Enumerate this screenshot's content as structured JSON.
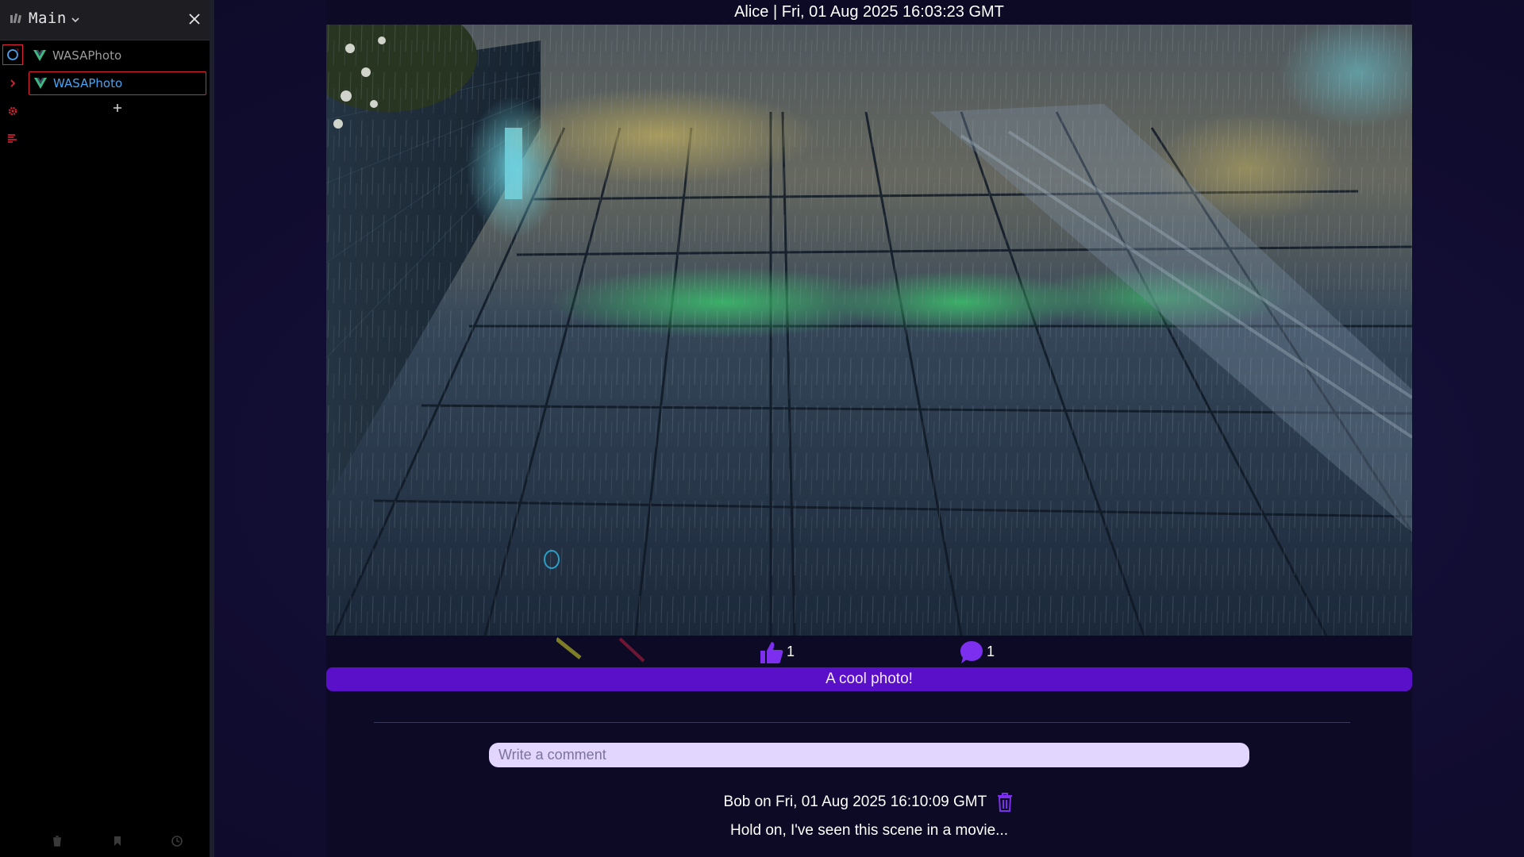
{
  "devtools": {
    "title": "Main",
    "side_icons": [
      "components-icon",
      "chevron-right-icon",
      "settings-icon",
      "timeline-icon"
    ],
    "component_tree": [
      {
        "label": "WASAPhoto",
        "selected": false
      },
      {
        "label": "WASAPhoto",
        "selected": true
      }
    ],
    "bottom_icons": [
      "trash-icon",
      "bookmark-icon",
      "clock-icon"
    ],
    "colors": {
      "accent_red": "#e0253b",
      "vue_green": "#41b883",
      "selected_blue": "#4aa3f0"
    }
  },
  "post": {
    "header": "Alice | Fri, 01 Aug 2025 16:03:23 GMT",
    "image_icon": "rainy-street-photo",
    "likes": {
      "icon": "thumbs-up-icon",
      "count": "1"
    },
    "comments": {
      "icon": "speech-bubble-icon",
      "count": "1"
    },
    "caption": "A cool photo!",
    "comment_input": {
      "placeholder": "Write a comment",
      "value": ""
    },
    "comment_list": [
      {
        "meta": "Bob on Fri, 01 Aug 2025 16:10:09 GMT",
        "text": "Hold on, I've seen this scene in a movie...",
        "delete_icon": "trash-icon"
      }
    ],
    "colors": {
      "caption_bg": "#5a10c8",
      "icon_purple": "#7d2ff0",
      "input_bg": "#e2d6ff"
    }
  }
}
